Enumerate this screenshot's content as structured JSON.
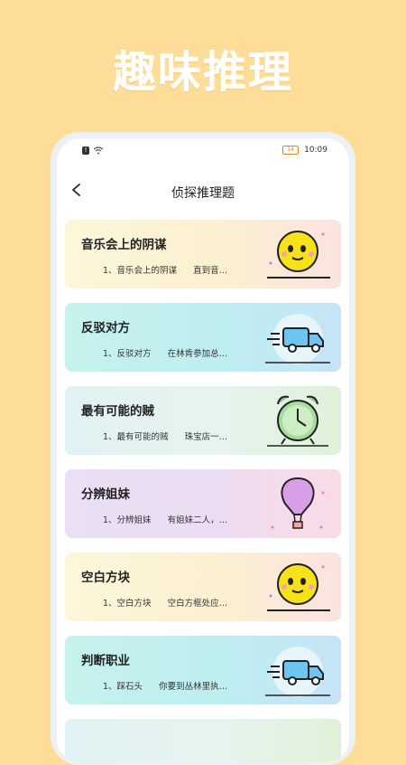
{
  "hero": {
    "title": "趣味推理"
  },
  "status_bar": {
    "time": "10:09",
    "battery": "14"
  },
  "nav": {
    "title": "侦探推理题"
  },
  "cards": [
    {
      "title": "音乐会上的阴谋",
      "subtitle": "1、音乐会上的阴谋      直到音…",
      "icon": "smiley-face-icon",
      "theme": "yellow"
    },
    {
      "title": "反驳对方",
      "subtitle": "1、反驳对方      在林肯参加总…",
      "icon": "delivery-truck-icon",
      "theme": "cyan"
    },
    {
      "title": "最有可能的贼",
      "subtitle": "1、最有可能的贼      珠宝店一…",
      "icon": "alarm-clock-icon",
      "theme": "green"
    },
    {
      "title": "分辨姐妹",
      "subtitle": "1、分辨姐妹      有姐妹二人，…",
      "icon": "hot-air-balloon-icon",
      "theme": "purple"
    },
    {
      "title": "空白方块",
      "subtitle": "1、空白方块      空白方框处应…",
      "icon": "smiley-face-icon",
      "theme": "yellow"
    },
    {
      "title": "判断职业",
      "subtitle": "1、踩石头      你要到丛林里执…",
      "icon": "delivery-truck-icon",
      "theme": "cyan"
    },
    {
      "title": "",
      "subtitle": "",
      "icon": "",
      "theme": "green"
    }
  ],
  "colors": {
    "page_bg": "#fddd98",
    "accent": "#ffffff"
  }
}
